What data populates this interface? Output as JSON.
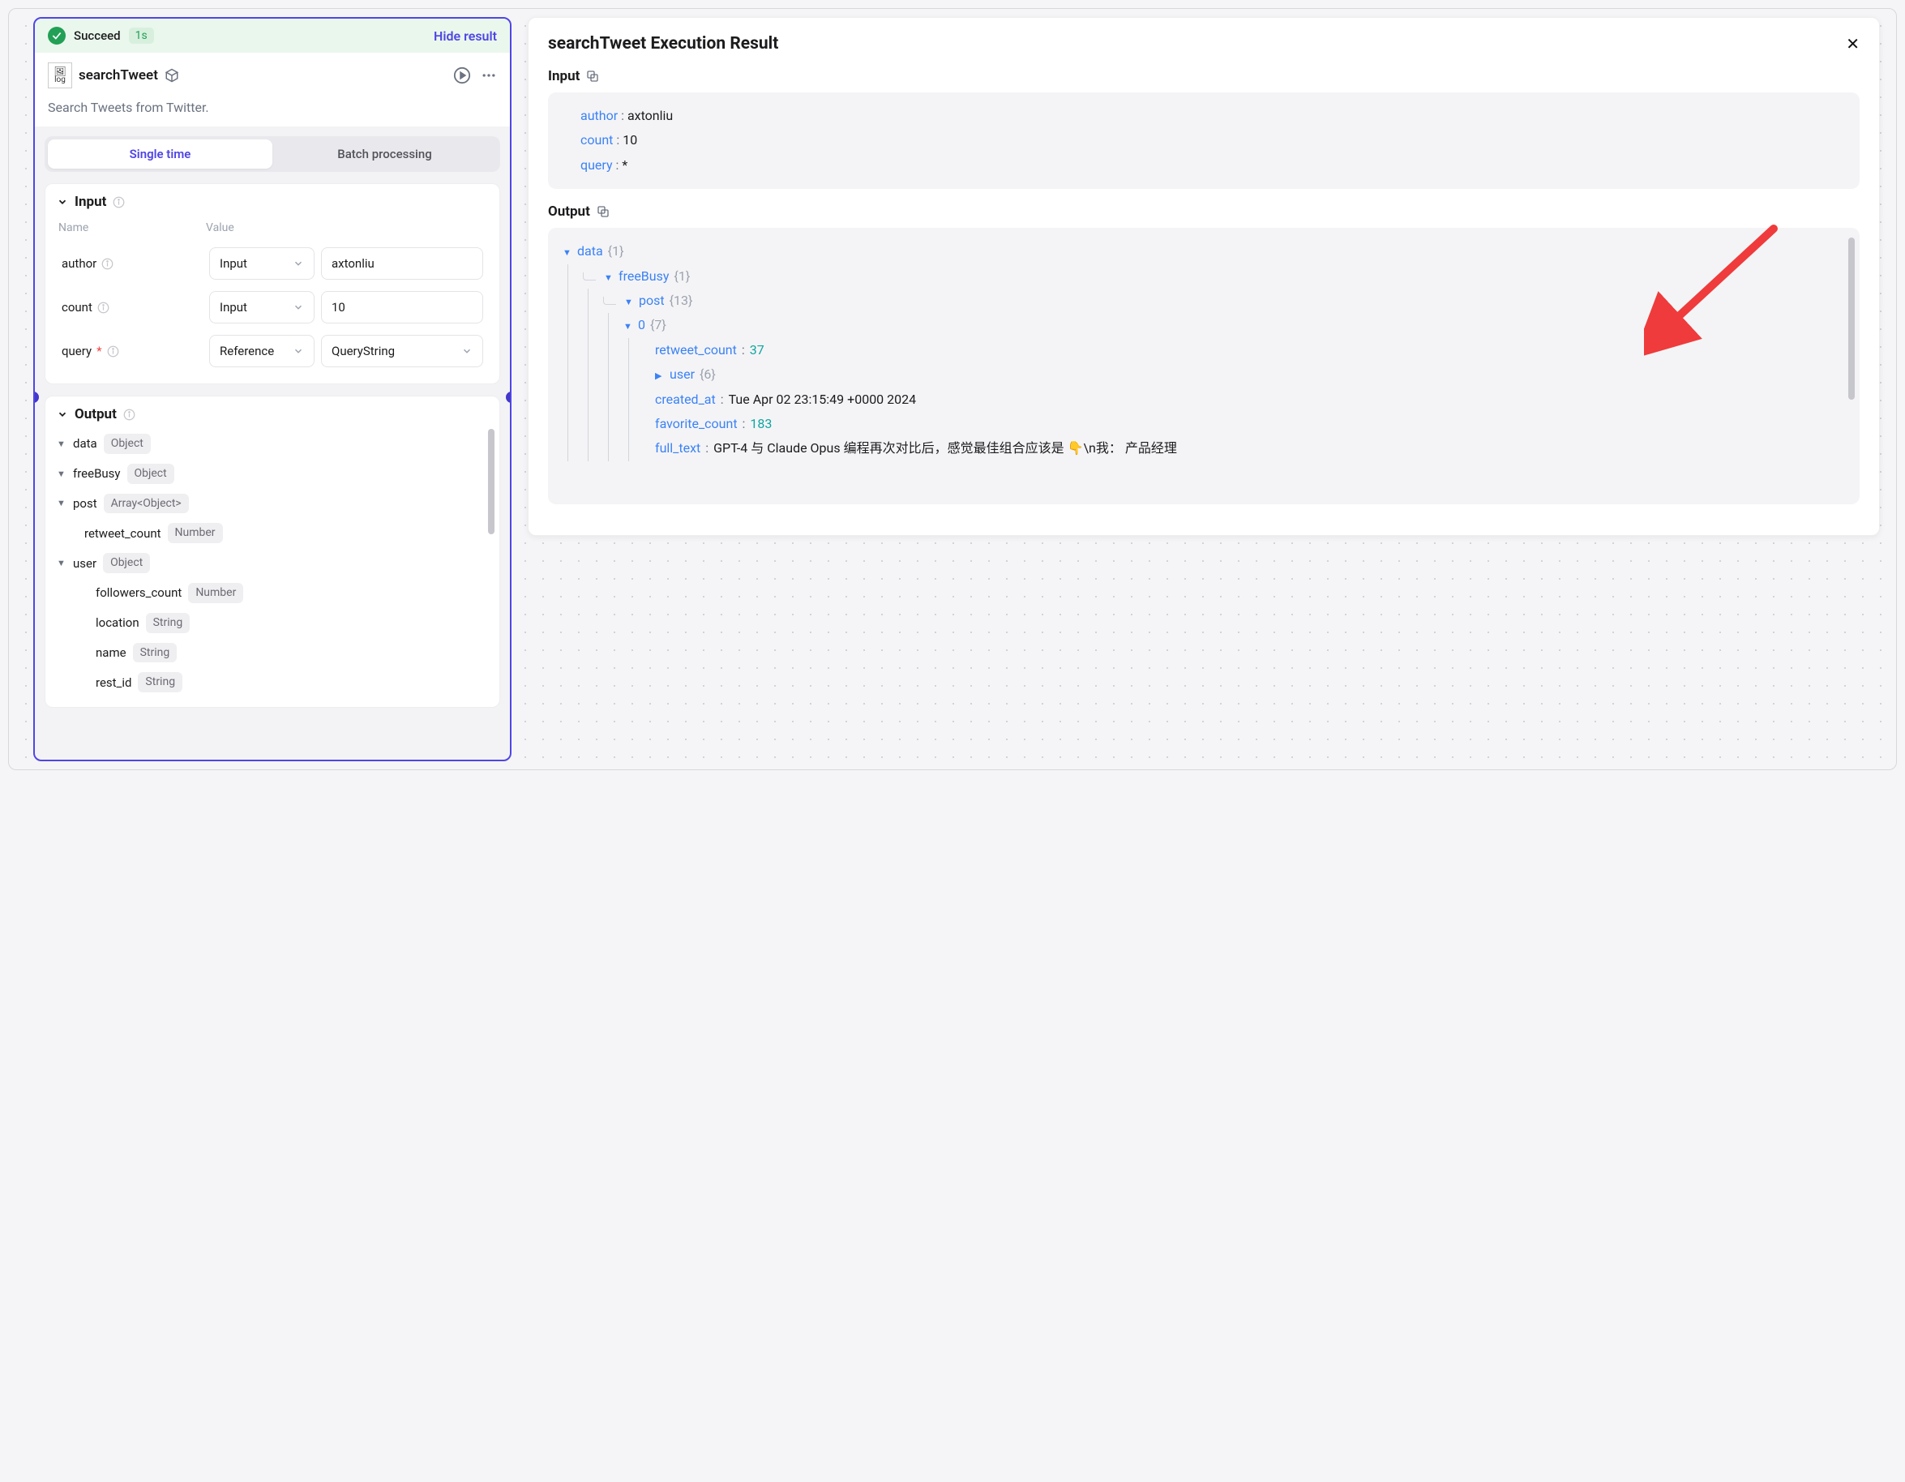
{
  "statusBar": {
    "statusText": "Succeed",
    "duration": "1s",
    "hideLabel": "Hide result"
  },
  "node": {
    "logoAlt": "log",
    "title": "searchTweet",
    "description": "Search Tweets from Twitter."
  },
  "tabs": {
    "single": "Single time",
    "batch": "Batch processing"
  },
  "inputSection": {
    "heading": "Input",
    "colName": "Name",
    "colValue": "Value",
    "rows": {
      "author": {
        "name": "author",
        "mode": "Input",
        "value": "axtonliu"
      },
      "count": {
        "name": "count",
        "mode": "Input",
        "value": "10"
      },
      "query": {
        "name": "query",
        "mode": "Reference",
        "value": "QueryString"
      }
    }
  },
  "outputSection": {
    "heading": "Output",
    "items": {
      "data": {
        "name": "data",
        "type": "Object"
      },
      "freeBusy": {
        "name": "freeBusy",
        "type": "Object"
      },
      "post": {
        "name": "post",
        "type": "Array<Object>"
      },
      "retweet_count": {
        "name": "retweet_count",
        "type": "Number"
      },
      "user": {
        "name": "user",
        "type": "Object"
      },
      "followers_count": {
        "name": "followers_count",
        "type": "Number"
      },
      "location": {
        "name": "location",
        "type": "String"
      },
      "name": {
        "name": "name",
        "type": "String"
      },
      "rest_id": {
        "name": "rest_id",
        "type": "String"
      }
    }
  },
  "resultPanel": {
    "title": "searchTweet Execution Result",
    "inputHeading": "Input",
    "outputHeading": "Output",
    "input": {
      "author": {
        "key": "author",
        "value": "axtonliu"
      },
      "count": {
        "key": "count",
        "value": "10"
      },
      "query": {
        "key": "query",
        "value": "*"
      }
    },
    "outputTree": {
      "data": {
        "key": "data",
        "count": "{1}"
      },
      "freeBusy": {
        "key": "freeBusy",
        "count": "{1}"
      },
      "post": {
        "key": "post",
        "count": "{13}"
      },
      "idx0": {
        "key": "0",
        "count": "{7}"
      },
      "retweet_count": {
        "key": "retweet_count",
        "value": "37"
      },
      "user": {
        "key": "user",
        "count": "{6}"
      },
      "created_at": {
        "key": "created_at",
        "value": "Tue Apr 02 23:15:49 +0000 2024"
      },
      "favorite_count": {
        "key": "favorite_count",
        "value": "183"
      },
      "full_text": {
        "key": "full_text",
        "value": "GPT-4 与 Claude Opus 编程再次对比后，感觉最佳组合应该是 👇\\n我： 产品经理"
      }
    }
  }
}
